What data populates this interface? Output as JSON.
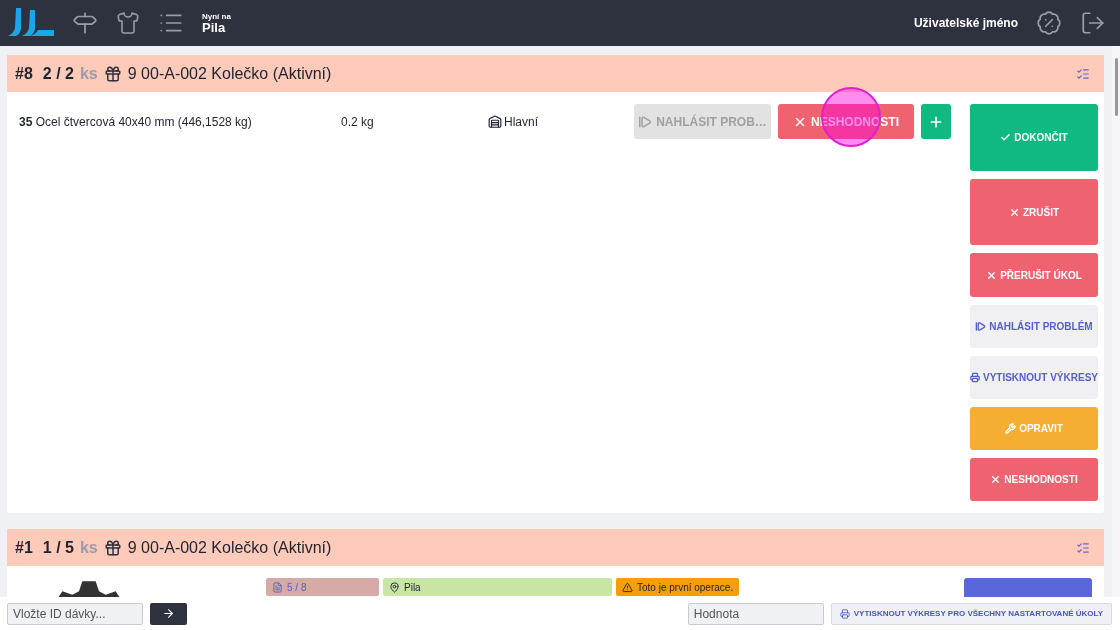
{
  "header": {
    "now_label": "Nyní na",
    "station": "Pila",
    "username": "Uživatelské jméno"
  },
  "tasks": [
    {
      "number": "#8",
      "count": "2 / 2",
      "unit": "ks",
      "product": "9 00-A-002 Kolečko (Aktivní)",
      "materials": [
        {
          "description": "**35** Ocel čtvercová 40x40 mm  (446,1528 kg)",
          "weight": "0.2 kg",
          "warehouse": "Hlavní"
        }
      ],
      "row_actions": [
        {
          "kind": "report",
          "label": "NAHLÁSIT PROB…",
          "disabled": true
        },
        {
          "kind": "nonconformity",
          "label": "NESHODNOSTI",
          "disabled": false
        },
        {
          "kind": "add",
          "disabled": false
        }
      ],
      "actions": [
        {
          "kind": "finish",
          "label": "DOKONČIT"
        },
        {
          "kind": "cancel",
          "label": "ZRUŠIT"
        },
        {
          "kind": "interrupt",
          "label": "PŘERUŠIT ÚKOL"
        },
        {
          "kind": "report",
          "label": "NAHLÁSIT PROBLÉM"
        },
        {
          "kind": "print",
          "label": "VYTISKNOUT VÝKRESY"
        },
        {
          "kind": "repair",
          "label": "OPRAVIT"
        },
        {
          "kind": "nonconformity",
          "label": "NESHODNOSTI"
        }
      ]
    },
    {
      "number": "#1",
      "count": "1 / 5",
      "unit": "ks",
      "product": "9 00-A-002 Kolečko (Aktivní)",
      "tags": [
        {
          "kind": "count",
          "text": "5 / 8"
        },
        {
          "kind": "location",
          "text": "Pila"
        },
        {
          "kind": "warning",
          "text": "Toto je první operace."
        }
      ],
      "actions": [
        {
          "kind": "start"
        }
      ]
    }
  ],
  "footer": {
    "batch_placeholder": "Vložte ID dávky...",
    "value_placeholder": "Hodnota",
    "print_all": "VYTISKNOUT VÝKRESY PRO VŠECHNY NASTARTOVANÉ ÚKOLY"
  }
}
